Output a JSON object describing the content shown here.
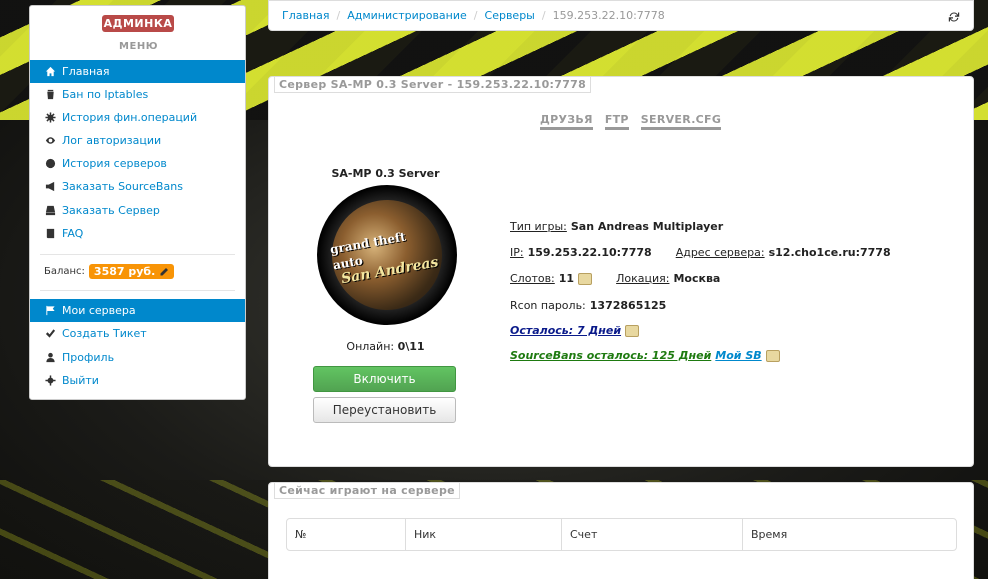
{
  "sidebar": {
    "brand": "АДМИНКА",
    "menu_title": "МЕНЮ",
    "items": [
      {
        "label": "Главная",
        "icon": "home-icon"
      },
      {
        "label": "Бан по Iptables",
        "icon": "trash-icon"
      },
      {
        "label": "История фин.операций",
        "icon": "gear-icon"
      },
      {
        "label": "Лог авторизации",
        "icon": "eye-icon"
      },
      {
        "label": "История серверов",
        "icon": "globe-icon"
      },
      {
        "label": "Заказать SourceBans",
        "icon": "bullhorn-icon"
      },
      {
        "label": "Заказать Сервер",
        "icon": "hdd-icon"
      },
      {
        "label": "FAQ",
        "icon": "book-icon"
      }
    ],
    "balance_label": "Баланс:",
    "balance_value": "3587 руб.",
    "items2": [
      {
        "label": "Мои сервера",
        "icon": "flag-icon"
      },
      {
        "label": "Создать Тикет",
        "icon": "check-icon"
      },
      {
        "label": "Профиль",
        "icon": "user-icon"
      },
      {
        "label": "Выйти",
        "icon": "cog-icon"
      }
    ]
  },
  "breadcrumb": {
    "items": [
      "Главная",
      "Администрирование",
      "Серверы"
    ],
    "current": "159.253.22.10:7778"
  },
  "server_panel": {
    "legend": "Сервер SA-MP 0.3 Server - 159.253.22.10:7778",
    "tabs": [
      "ДРУЗЬЯ",
      "FTP",
      "SERVER.CFG"
    ],
    "server_name": "SA-MP 0.3 Server",
    "logo_text_top": "grand theft auto",
    "logo_text_bottom": "San Andreas",
    "online_label": "Онлайн:",
    "online_value": "0\\11",
    "btn_start": "Включить",
    "btn_reinstall": "Переустановить",
    "game_type_label": "Тип игры:",
    "game_type": "San Andreas Multiplayer",
    "ip_label": "IP:",
    "ip": "159.253.22.10:7778",
    "address_label": "Адрес сервера:",
    "address": "s12.cho1ce.ru:7778",
    "slots_label": "Слотов:",
    "slots": "11",
    "location_label": "Локация:",
    "location": "Москва",
    "rcon_label": "Rcon пароль:",
    "rcon": "1372865125",
    "remaining": "Осталось: 7 Дней",
    "sb_remaining": "SourceBans осталось: 125 Дней",
    "sb_link": "Мой SB"
  },
  "players_panel": {
    "legend": "Сейчас играют на сервере",
    "columns": [
      "№",
      "Ник",
      "Счет",
      "Время"
    ]
  }
}
